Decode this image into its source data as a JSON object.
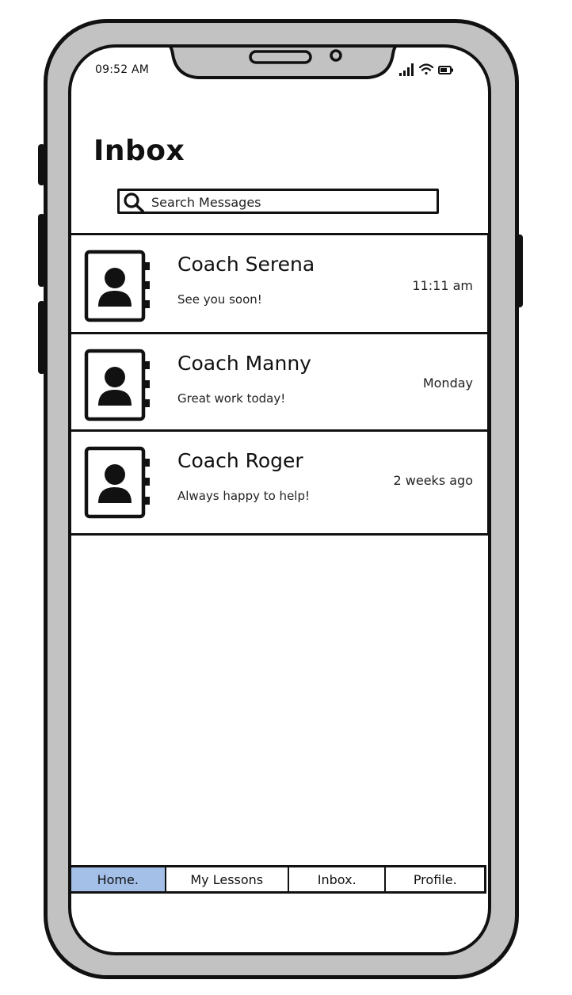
{
  "status_bar": {
    "time": "09:52 AM"
  },
  "header": {
    "title": "Inbox"
  },
  "search": {
    "placeholder": "Search Messages",
    "icon": "search-icon"
  },
  "conversations": [
    {
      "name": "Coach Serena",
      "preview": "See you soon!",
      "time": "11:11 am"
    },
    {
      "name": "Coach Manny",
      "preview": "Great work today!",
      "time": "Monday"
    },
    {
      "name": "Coach Roger",
      "preview": "Always happy to help!",
      "time": "2 weeks ago"
    }
  ],
  "tabs": [
    {
      "label": "Home.",
      "active": true
    },
    {
      "label": "My Lessons",
      "active": false
    },
    {
      "label": "Inbox.",
      "active": false
    },
    {
      "label": "Profile.",
      "active": false
    }
  ],
  "colors": {
    "active_tab": "#a4bfe8",
    "frame": "#c2c2c2",
    "stroke": "#111111"
  }
}
